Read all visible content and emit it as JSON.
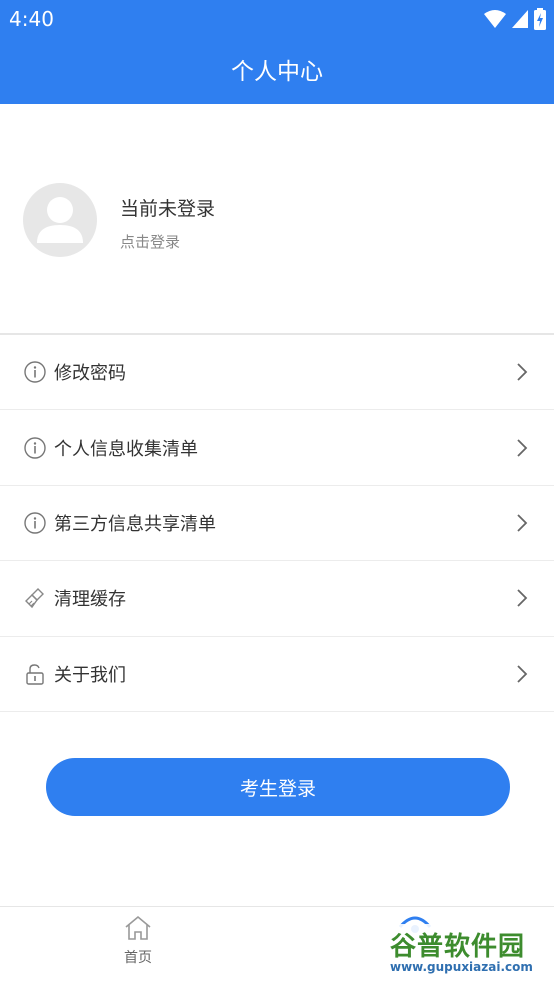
{
  "status_bar": {
    "time": "4:40"
  },
  "header": {
    "title": "个人中心"
  },
  "profile": {
    "name": "当前未登录",
    "subtitle": "点击登录"
  },
  "menu": {
    "items": [
      {
        "label": "修改密码",
        "icon": "info-icon"
      },
      {
        "label": "个人信息收集清单",
        "icon": "info-icon"
      },
      {
        "label": "第三方信息共享清单",
        "icon": "info-icon"
      },
      {
        "label": "清理缓存",
        "icon": "broom-icon"
      },
      {
        "label": "关于我们",
        "icon": "unlock-icon"
      }
    ]
  },
  "login_button": {
    "label": "考生登录"
  },
  "tab_bar": {
    "home_label": "首页"
  },
  "watermark": {
    "title": "谷普软件园",
    "url": "www.gupuxiazai.com"
  },
  "colors": {
    "primary": "#2f7ff0",
    "background": "#ffffff",
    "divider": "#ececec"
  }
}
